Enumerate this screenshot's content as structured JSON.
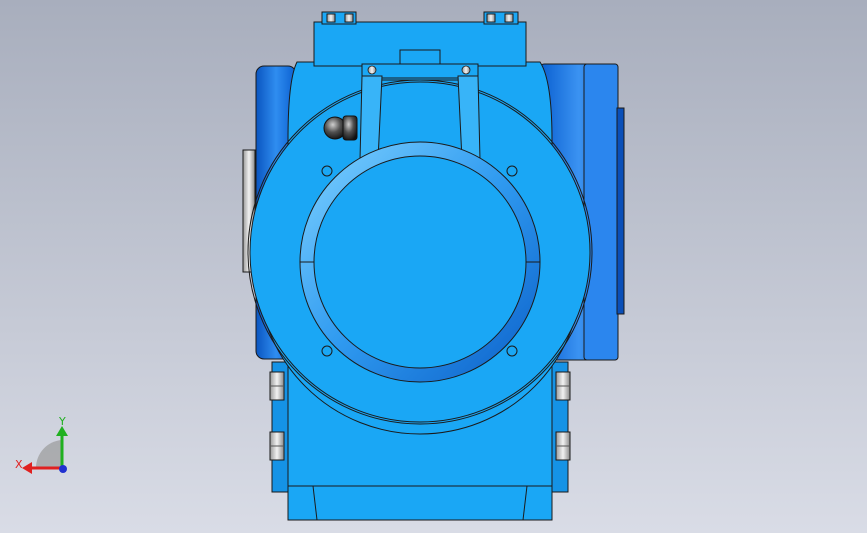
{
  "viewport": {
    "background_top": "#a8aebd",
    "background_bottom": "#d9dce6"
  },
  "model": {
    "color_main": "#1aa7f5",
    "color_dark": "#0a6fd6",
    "color_outline": "#1a1a1a"
  },
  "triad": {
    "x_label": "X",
    "y_label": "Y",
    "x_color": "#e02020",
    "y_color": "#20b020",
    "z_color": "#2030d0"
  }
}
